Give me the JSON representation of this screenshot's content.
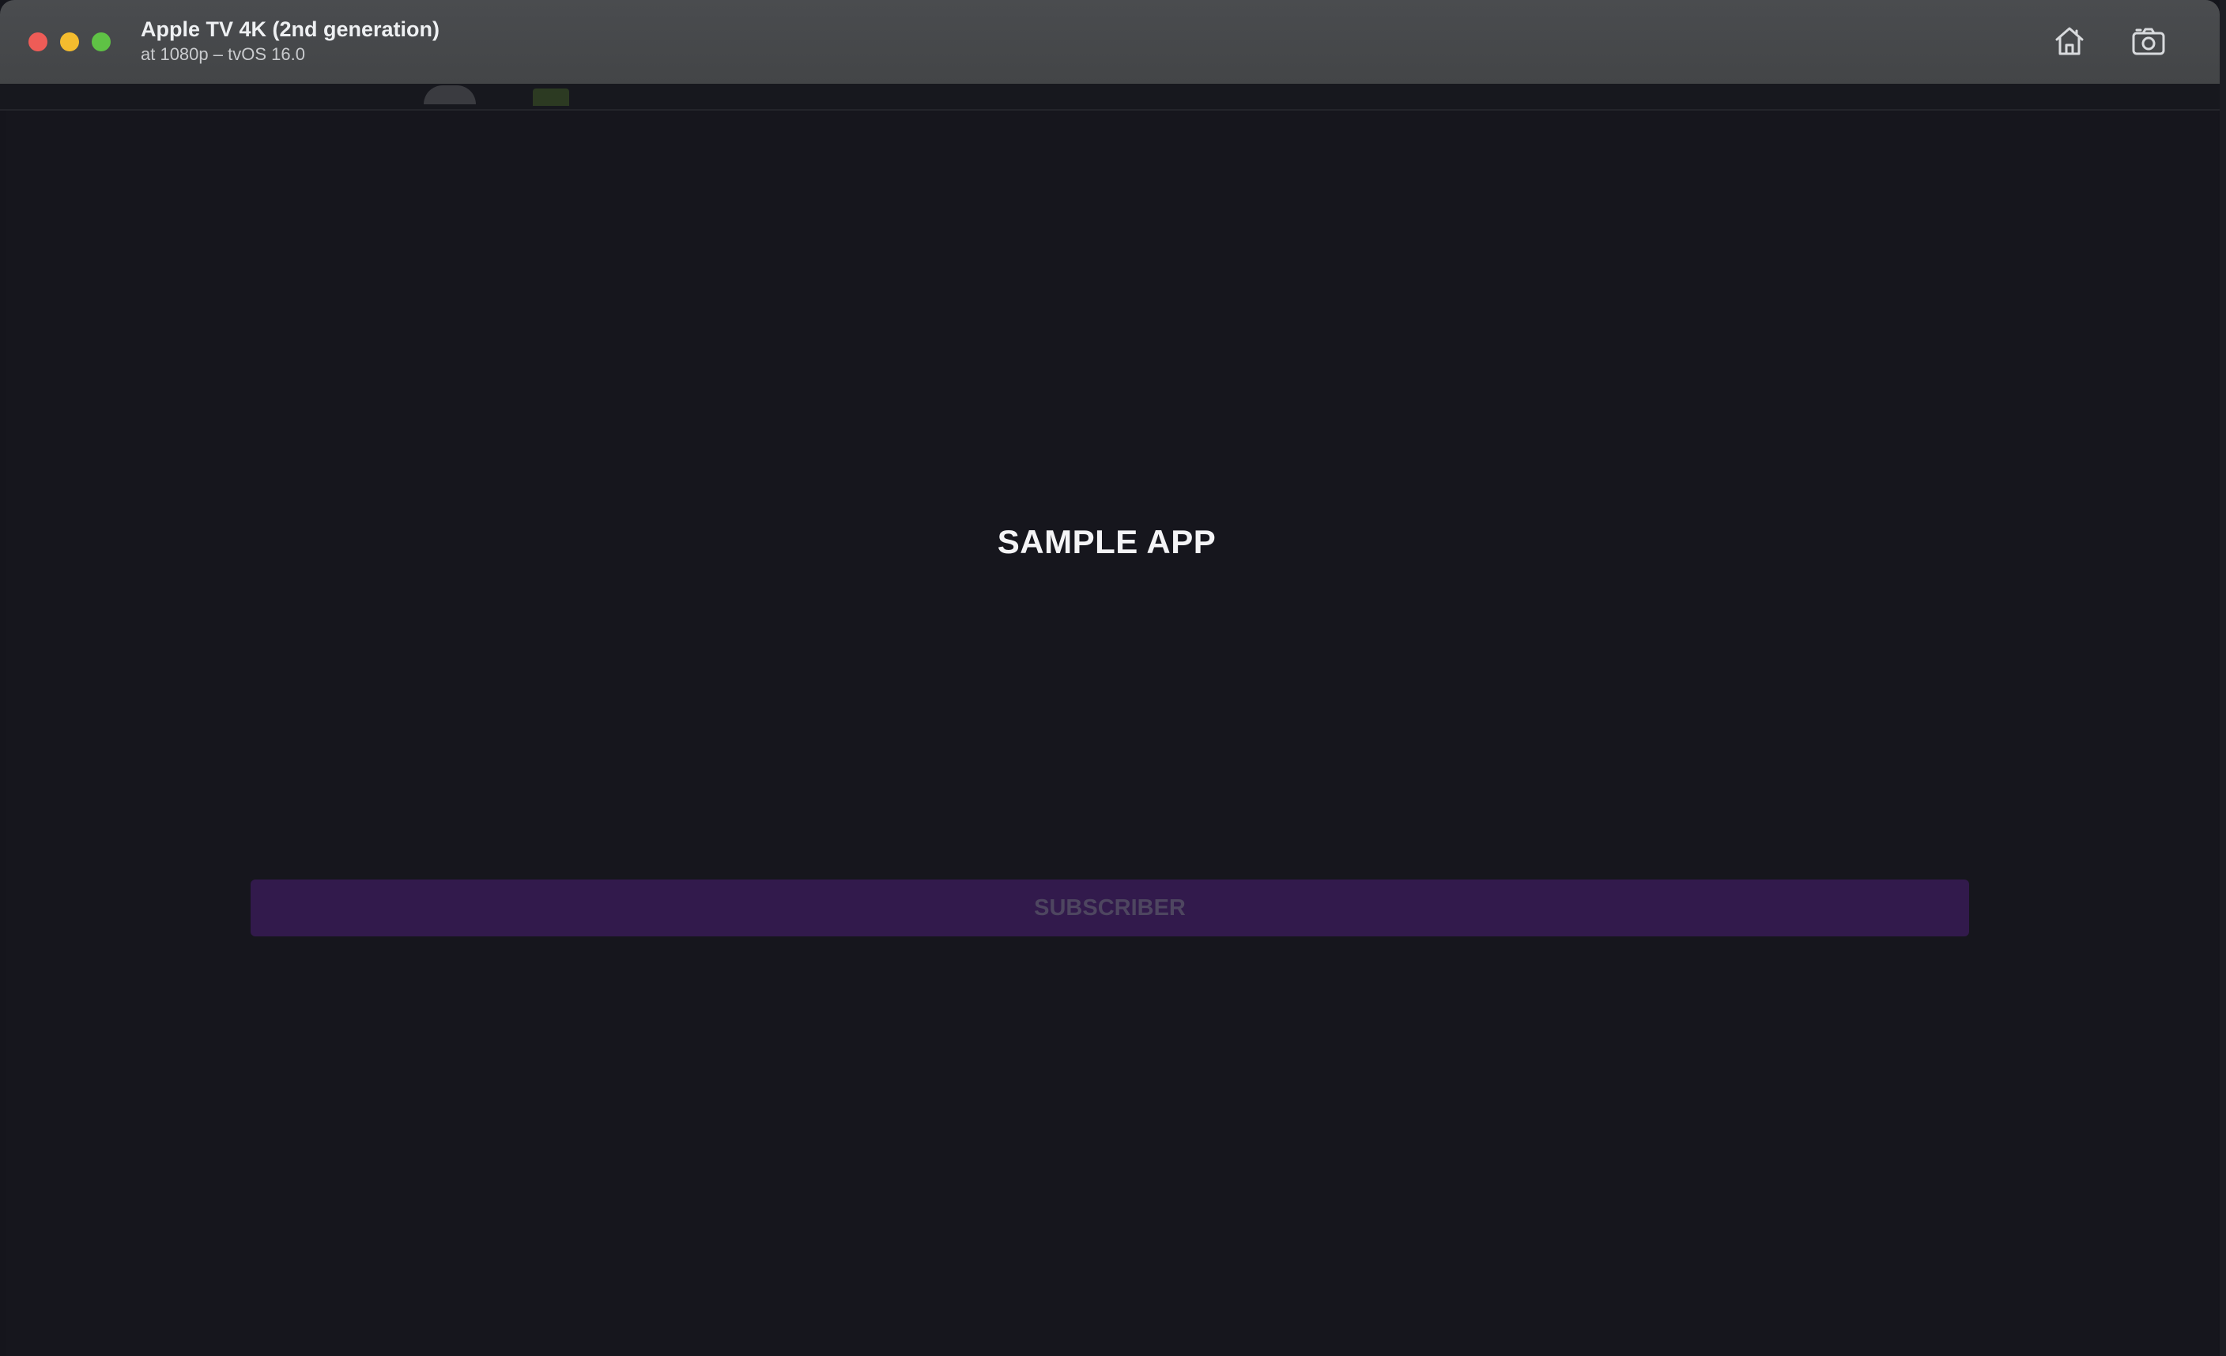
{
  "window": {
    "title": "Apple TV 4K (2nd generation)",
    "subtitle": "at 1080p – tvOS 16.0",
    "controls": [
      "close",
      "minimize",
      "zoom"
    ],
    "toolbar_icons": [
      "home-icon",
      "screenshot-icon"
    ]
  },
  "app": {
    "title": "SAMPLE APP",
    "subscriber_button": "SUBSCRIBER"
  },
  "colors": {
    "background": "#16161d",
    "button_bg": "#321a4c",
    "button_text": "#4e4660",
    "title_text": "#f4f4f6"
  }
}
